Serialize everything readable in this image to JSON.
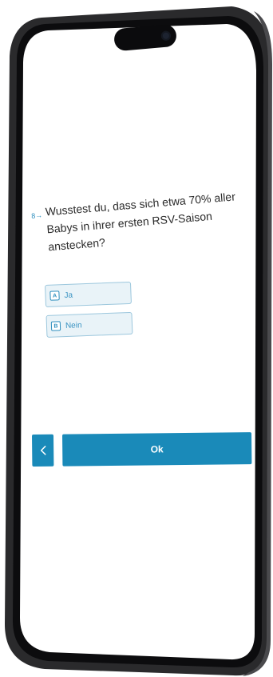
{
  "question": {
    "number": "8→",
    "text": "Wusstest du, dass sich etwa 70% aller Babys in ihrer ersten RSV-Saison anstecken?"
  },
  "choices": [
    {
      "key": "A",
      "label": "Ja"
    },
    {
      "key": "B",
      "label": "Nein"
    }
  ],
  "navigation": {
    "ok_label": "Ok"
  },
  "colors": {
    "accent": "#1a8ab9",
    "choice_bg": "#e9f3f8",
    "choice_border": "#9cc7dd",
    "text": "#2b2b2b"
  }
}
